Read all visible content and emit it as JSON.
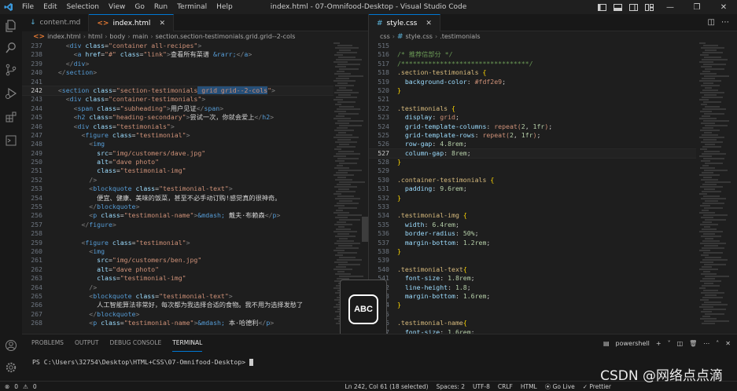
{
  "titlebar": {
    "menu": [
      "File",
      "Edit",
      "Selection",
      "View",
      "Go",
      "Run",
      "Terminal",
      "Help"
    ],
    "title": "index.html - 07-Omnifood-Desktop - Visual Studio Code"
  },
  "editor_left": {
    "tabs": [
      {
        "label": "content.md",
        "icon": "markdown-file-icon"
      },
      {
        "label": "index.html",
        "icon": "html-file-icon",
        "active": true
      }
    ],
    "breadcrumb": [
      "index.html",
      "html",
      "body",
      "main",
      "section.section-testimonials.grid.grid--2-cols"
    ],
    "lines": [
      {
        "n": "237",
        "html": "    <span class=\"tk-punct\">&lt;</span><span class=\"tk-tag\">div</span> <span class=\"tk-attr\">class</span>=<span class=\"tk-str\">\"container all-recipes\"</span><span class=\"tk-punct\">&gt;</span>"
      },
      {
        "n": "238",
        "html": "      <span class=\"tk-punct\">&lt;</span><span class=\"tk-tag\">a</span> <span class=\"tk-attr\">href</span>=<span class=\"tk-str\">\"#\"</span> <span class=\"tk-attr\">class</span>=<span class=\"tk-str\">\"link\"</span><span class=\"tk-punct\">&gt;</span><span class=\"tk-text\">查看所有菜谱 </span><span class=\"tk-ent\">&amp;rarr;</span><span class=\"tk-punct\">&lt;/</span><span class=\"tk-tag\">a</span><span class=\"tk-punct\">&gt;</span>"
      },
      {
        "n": "239",
        "html": "    <span class=\"tk-punct\">&lt;/</span><span class=\"tk-tag\">div</span><span class=\"tk-punct\">&gt;</span>"
      },
      {
        "n": "240",
        "html": "  <span class=\"tk-punct\">&lt;/</span><span class=\"tk-tag\">section</span><span class=\"tk-punct\">&gt;</span>"
      },
      {
        "n": "241",
        "html": ""
      },
      {
        "n": "242",
        "cur": true,
        "html": "  <span class=\"tk-punct\">&lt;</span><span class=\"tk-tag\">section</span> <span class=\"tk-attr\">class</span>=<span class=\"tk-str\">\"section-testimonials<span class=\"hl\"> grid grid--2-cols</span>\"</span><span class=\"tk-punct\">&gt;</span>"
      },
      {
        "n": "243",
        "html": "    <span class=\"tk-punct\">&lt;</span><span class=\"tk-tag\">div</span> <span class=\"tk-attr\">class</span>=<span class=\"tk-str\">\"container-testimonials\"</span><span class=\"tk-punct\">&gt;</span>"
      },
      {
        "n": "244",
        "html": "      <span class=\"tk-punct\">&lt;</span><span class=\"tk-tag\">span</span> <span class=\"tk-attr\">class</span>=<span class=\"tk-str\">\"subheading\"</span><span class=\"tk-punct\">&gt;</span><span class=\"tk-text\">用户见证</span><span class=\"tk-punct\">&lt;/</span><span class=\"tk-tag\">span</span><span class=\"tk-punct\">&gt;</span>"
      },
      {
        "n": "245",
        "html": "      <span class=\"tk-punct\">&lt;</span><span class=\"tk-tag\">h2</span> <span class=\"tk-attr\">class</span>=<span class=\"tk-str\">\"heading-secondary\"</span><span class=\"tk-punct\">&gt;</span><span class=\"tk-text\">尝试一次，你就会爱上</span><span class=\"tk-punct\">&lt;/</span><span class=\"tk-tag\">h2</span><span class=\"tk-punct\">&gt;</span>"
      },
      {
        "n": "246",
        "html": "      <span class=\"tk-punct\">&lt;</span><span class=\"tk-tag\">div</span> <span class=\"tk-attr\">class</span>=<span class=\"tk-str\">\"testimonials\"</span><span class=\"tk-punct\">&gt;</span>"
      },
      {
        "n": "247",
        "html": "        <span class=\"tk-punct\">&lt;</span><span class=\"tk-tag\">figure</span> <span class=\"tk-attr\">class</span>=<span class=\"tk-str\">\"testimonial\"</span><span class=\"tk-punct\">&gt;</span>"
      },
      {
        "n": "248",
        "html": "          <span class=\"tk-punct\">&lt;</span><span class=\"tk-tag\">img</span>"
      },
      {
        "n": "249",
        "html": "            <span class=\"tk-attr\">src</span>=<span class=\"tk-str\">\"img/customers/dave.jpg\"</span>"
      },
      {
        "n": "250",
        "html": "            <span class=\"tk-attr\">alt</span>=<span class=\"tk-str\">\"dave photo\"</span>"
      },
      {
        "n": "251",
        "html": "            <span class=\"tk-attr\">class</span>=<span class=\"tk-str\">\"testimonial-img\"</span>"
      },
      {
        "n": "252",
        "html": "          <span class=\"tk-punct\">/&gt;</span>"
      },
      {
        "n": "253",
        "html": "          <span class=\"tk-punct\">&lt;</span><span class=\"tk-tag\">blockquote</span> <span class=\"tk-attr\">class</span>=<span class=\"tk-str\">\"testimonial-text\"</span><span class=\"tk-punct\">&gt;</span>"
      },
      {
        "n": "254",
        "html": "            <span class=\"tk-text\">便宜、健康、美味的饭菜，甚至不必手动订购!感觉真的很神奇。</span>"
      },
      {
        "n": "255",
        "html": "          <span class=\"tk-punct\">&lt;/</span><span class=\"tk-tag\">blockquote</span><span class=\"tk-punct\">&gt;</span>"
      },
      {
        "n": "256",
        "html": "          <span class=\"tk-punct\">&lt;</span><span class=\"tk-tag\">p</span> <span class=\"tk-attr\">class</span>=<span class=\"tk-str\">\"testimonial-name\"</span><span class=\"tk-punct\">&gt;</span><span class=\"tk-ent\">&amp;mdash;</span><span class=\"tk-text\"> 戴夫·布赖森</span><span class=\"tk-punct\">&lt;/</span><span class=\"tk-tag\">p</span><span class=\"tk-punct\">&gt;</span>"
      },
      {
        "n": "257",
        "html": "        <span class=\"tk-punct\">&lt;/</span><span class=\"tk-tag\">figure</span><span class=\"tk-punct\">&gt;</span>"
      },
      {
        "n": "258",
        "html": ""
      },
      {
        "n": "259",
        "html": "        <span class=\"tk-punct\">&lt;</span><span class=\"tk-tag\">figure</span> <span class=\"tk-attr\">class</span>=<span class=\"tk-str\">\"testimonial\"</span><span class=\"tk-punct\">&gt;</span>"
      },
      {
        "n": "260",
        "html": "          <span class=\"tk-punct\">&lt;</span><span class=\"tk-tag\">img</span>"
      },
      {
        "n": "261",
        "html": "            <span class=\"tk-attr\">src</span>=<span class=\"tk-str\">\"img/customers/ben.jpg\"</span>"
      },
      {
        "n": "262",
        "html": "            <span class=\"tk-attr\">alt</span>=<span class=\"tk-str\">\"dave photo\"</span>"
      },
      {
        "n": "263",
        "html": "            <span class=\"tk-attr\">class</span>=<span class=\"tk-str\">\"testimonial-img\"</span>"
      },
      {
        "n": "264",
        "html": "          <span class=\"tk-punct\">/&gt;</span>"
      },
      {
        "n": "265",
        "html": "          <span class=\"tk-punct\">&lt;</span><span class=\"tk-tag\">blockquote</span> <span class=\"tk-attr\">class</span>=<span class=\"tk-str\">\"testimonial-text\"</span><span class=\"tk-punct\">&gt;</span>"
      },
      {
        "n": "266",
        "html": "            <span class=\"tk-text\">人工智能算法非常好，每次都为我选择合适的食物。我不用为选择发愁了</span>"
      },
      {
        "n": "267",
        "html": "          <span class=\"tk-punct\">&lt;/</span><span class=\"tk-tag\">blockquote</span><span class=\"tk-punct\">&gt;</span>"
      },
      {
        "n": "268",
        "html": "          <span class=\"tk-punct\">&lt;</span><span class=\"tk-tag\">p</span> <span class=\"tk-attr\">class</span>=<span class=\"tk-str\">\"testimonial-name\"</span><span class=\"tk-punct\">&gt;</span><span class=\"tk-ent\">&amp;mdash;</span><span class=\"tk-text\"> 本·哈德利</span><span class=\"tk-punct\">&lt;/</span><span class=\"tk-tag\">p</span><span class=\"tk-punct\">&gt;</span>"
      }
    ]
  },
  "editor_right": {
    "tabs": [
      {
        "label": "style.css",
        "icon": "css-file-icon",
        "active": true
      }
    ],
    "breadcrumb": [
      "css",
      "style.css",
      ".testimonials"
    ],
    "lines": [
      {
        "n": "515",
        "html": ""
      },
      {
        "n": "516",
        "html": "<span class=\"tk-com\">/* 推荐信部分 */</span>"
      },
      {
        "n": "517",
        "html": "<span class=\"tk-com\">/*********************************/</span>"
      },
      {
        "n": "518",
        "html": "<span class=\"tk-sel\">.section-testimonials</span> <span class=\"tk-br\">{</span>"
      },
      {
        "n": "519",
        "html": "  <span class=\"tk-prop\">background-color</span>: <span class=\"tk-str\">#fdf2e9</span>;"
      },
      {
        "n": "520",
        "html": "<span class=\"tk-br\">}</span>"
      },
      {
        "n": "521",
        "html": ""
      },
      {
        "n": "522",
        "html": "<span class=\"tk-sel\">.testimonials</span> <span class=\"tk-br\">{</span>"
      },
      {
        "n": "523",
        "html": "  <span class=\"tk-prop\">display</span>: <span class=\"tk-str\">grid</span>;"
      },
      {
        "n": "524",
        "html": "  <span class=\"tk-prop\">grid-template-columns</span>: <span class=\"tk-str\">repeat(</span><span class=\"tk-num\">2</span>, <span class=\"tk-num\">1fr</span><span class=\"tk-str\">)</span>;"
      },
      {
        "n": "525",
        "html": "  <span class=\"tk-prop\">grid-template-rows</span>: <span class=\"tk-str\">repeat(</span><span class=\"tk-num\">2</span>, <span class=\"tk-num\">1fr</span><span class=\"tk-str\">)</span>;"
      },
      {
        "n": "526",
        "html": "  <span class=\"tk-prop\">row-gap</span>: <span class=\"tk-num\">4.8rem</span>;"
      },
      {
        "n": "527",
        "cur": true,
        "html": "  <span class=\"tk-prop\">column-gap</span>: <span class=\"tk-num\">8rem</span>;"
      },
      {
        "n": "528",
        "html": "<span class=\"tk-br\">}</span>"
      },
      {
        "n": "529",
        "html": ""
      },
      {
        "n": "530",
        "html": "<span class=\"tk-sel\">.container-testimonials</span> <span class=\"tk-br\">{</span>"
      },
      {
        "n": "531",
        "html": "  <span class=\"tk-prop\">padding</span>: <span class=\"tk-num\">9.6rem</span>;"
      },
      {
        "n": "532",
        "html": "<span class=\"tk-br\">}</span>"
      },
      {
        "n": "533",
        "html": ""
      },
      {
        "n": "534",
        "html": "<span class=\"tk-sel\">.testimonial-img</span> <span class=\"tk-br\">{</span>"
      },
      {
        "n": "535",
        "html": "  <span class=\"tk-prop\">width</span>: <span class=\"tk-num\">6.4rem</span>;"
      },
      {
        "n": "536",
        "html": "  <span class=\"tk-prop\">border-radius</span>: <span class=\"tk-num\">50%</span>;"
      },
      {
        "n": "537",
        "html": "  <span class=\"tk-prop\">margin-bottom</span>: <span class=\"tk-num\">1.2rem</span>;"
      },
      {
        "n": "538",
        "html": "<span class=\"tk-br\">}</span>"
      },
      {
        "n": "539",
        "html": ""
      },
      {
        "n": "540",
        "html": "<span class=\"tk-sel\">.testimonial-text</span><span class=\"tk-br\">{</span>"
      },
      {
        "n": "541",
        "html": "  <span class=\"tk-prop\">font-size</span>: <span class=\"tk-num\">1.8rem</span>;"
      },
      {
        "n": "542",
        "html": "  <span class=\"tk-prop\">line-height</span>: <span class=\"tk-num\">1.8</span>;"
      },
      {
        "n": "543",
        "html": "  <span class=\"tk-prop\">margin-bottom</span>: <span class=\"tk-num\">1.6rem</span>;"
      },
      {
        "n": "544",
        "html": "<span class=\"tk-br\">}</span>"
      },
      {
        "n": "545",
        "html": ""
      },
      {
        "n": "546",
        "html": "<span class=\"tk-sel\">.testimonial-name</span><span class=\"tk-br\">{</span>"
      },
      {
        "n": "547",
        "html": "  <span class=\"tk-prop\">font-size</span>: <span class=\"tk-num\">1.6rem</span>;"
      }
    ]
  },
  "ime": {
    "label": "ABC"
  },
  "panel": {
    "tabs": [
      "PROBLEMS",
      "OUTPUT",
      "DEBUG CONSOLE",
      "TERMINAL"
    ],
    "active_tab": "TERMINAL",
    "shell": "powershell",
    "prompt": "PS C:\\Users\\32754\\Desktop\\HTML+CSS\\07-Omnifood-Desktop>"
  },
  "statusbar": {
    "errors": "0",
    "warnings": "0",
    "position": "Ln 242, Col 61 (18 selected)",
    "spaces": "Spaces: 2",
    "encoding": "UTF-8",
    "eol": "CRLF",
    "language": "HTML",
    "golive": "Go Live",
    "prettier": "Prettier"
  },
  "watermark": "CSDN @网络点点滴"
}
